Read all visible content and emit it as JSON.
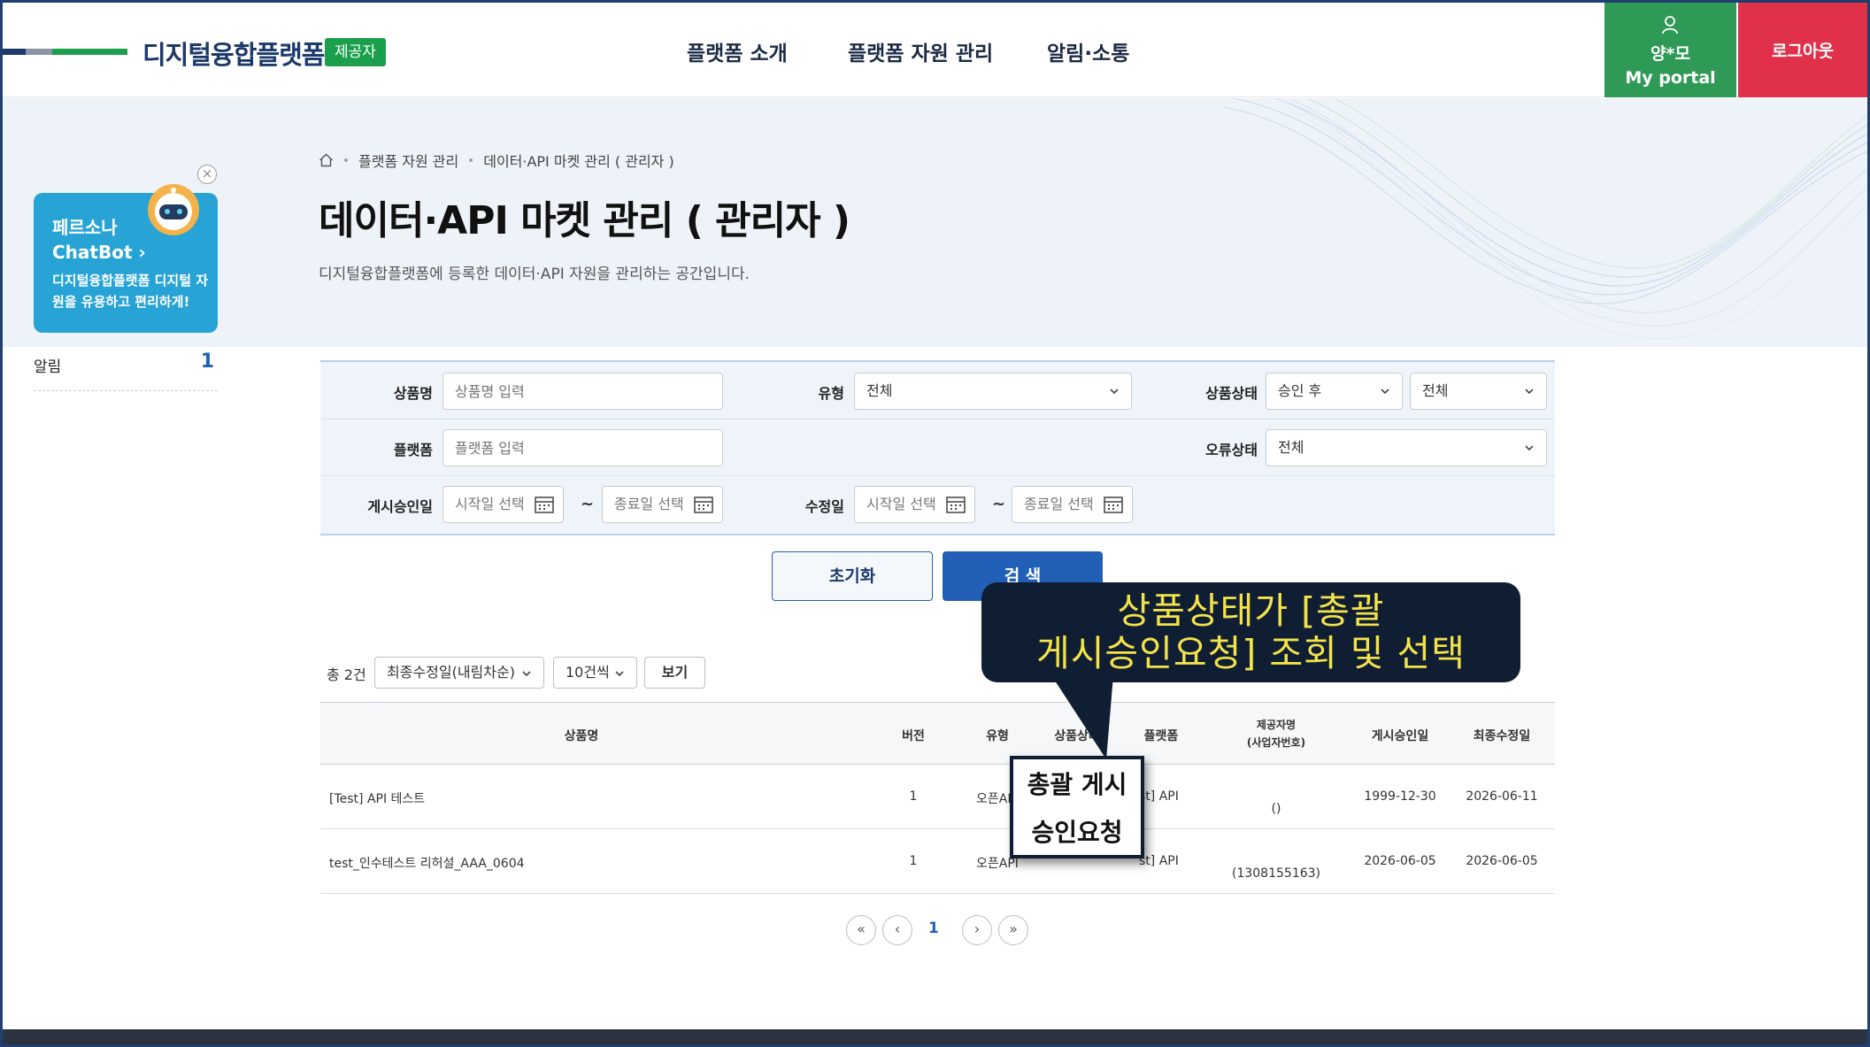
{
  "header": {
    "logo_text": "디지털융합플랫폼",
    "role_badge": "제공자",
    "nav": [
      "플랫폼 소개",
      "플랫폼 자원 관리",
      "알림·소통"
    ],
    "user_name": "양*모",
    "portal_label": "My portal",
    "logout_label": "로그아웃",
    "colors": {
      "portal_bg": "#2f9a56",
      "logout_bg": "#e1314a"
    }
  },
  "breadcrumb": [
    "플랫폼 자원 관리",
    "데이터·API 마켓 관리 ( 관리자 )"
  ],
  "page": {
    "title": "데이터·API 마켓 관리 ( 관리자 )",
    "description": "디지털융합플랫폼에 등록한 데이터·API 자원을 관리하는 공간입니다."
  },
  "chatbot": {
    "name_line1": "페르소나",
    "name_line2": "ChatBot",
    "desc": "디지털융합플랫폼 디지털 자원을 유용하고 편리하게!"
  },
  "notice": {
    "label": "알림",
    "count": "1"
  },
  "search": {
    "product_name": {
      "label": "상품명",
      "placeholder": "상품명 입력"
    },
    "type": {
      "label": "유형",
      "value": "전체"
    },
    "product_status": {
      "label": "상품상태",
      "value1": "승인 후",
      "value2": "전체"
    },
    "platform": {
      "label": "플랫폼",
      "placeholder": "플랫폼 입력"
    },
    "error_status": {
      "label": "오류상태",
      "value": "전체"
    },
    "post_approval_date": {
      "label": "게시승인일",
      "start_placeholder": "시작일 선택",
      "end_placeholder": "종료일 선택"
    },
    "modified_date": {
      "label": "수정일",
      "start_placeholder": "시작일 선택",
      "end_placeholder": "종료일 선택"
    },
    "tilde": "~",
    "reset_label": "초기화",
    "search_label": "검 색"
  },
  "list": {
    "total": "총 2건",
    "sort": "최종수정일(내림차순)",
    "page_size": "10건씩",
    "view_label": "보기"
  },
  "table": {
    "headers": {
      "name": "상품명",
      "version": "버전",
      "type": "유형",
      "status": "상품상태",
      "platform": "플랫폼",
      "provider_line1": "제공자명",
      "provider_line2": "(사업자번호)",
      "approved": "게시승인일",
      "modified": "최종수정일"
    },
    "rows": [
      {
        "name": "[Test] API 테스트",
        "version": "1",
        "type": "오픈API",
        "platform": "st] API",
        "provider": "()",
        "approved": "1999-12-30",
        "modified": "2026-06-11"
      },
      {
        "name": "test_인수테스트 리허설_AAA_0604",
        "version": "1",
        "type": "오픈API",
        "platform": "st] API",
        "provider": "(1308155163)",
        "approved": "2026-06-05",
        "modified": "2026-06-05"
      }
    ]
  },
  "pagination": {
    "current": "1"
  },
  "annotation": {
    "callout_line1": "상품상태가 [총괄",
    "callout_line2": "게시승인요청] 조회 및 선택",
    "status_line1": "총괄 게시",
    "status_line2": "승인요청",
    "callout_text_color": "#f3e24a"
  }
}
